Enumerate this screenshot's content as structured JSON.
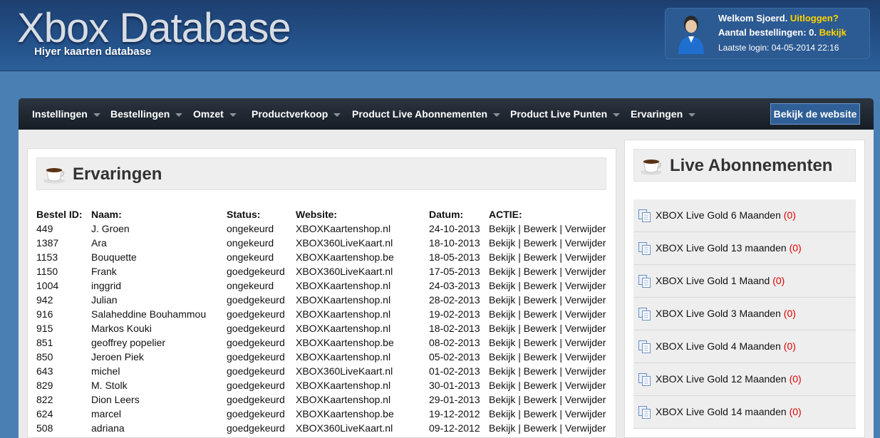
{
  "header": {
    "title": "Xbox Database",
    "subtitle": "Hiyer kaarten database",
    "user": {
      "welcome_prefix": "Welkom ",
      "username": "Sjoerd",
      "dot": ". ",
      "logout": "Uitloggen?",
      "orders_prefix": "Aantal bestellingen: 0. ",
      "view": "Bekijk",
      "last_login": "Laatste login: 04-05-2014 22:16"
    }
  },
  "nav": {
    "items": [
      {
        "label": "Instellingen"
      },
      {
        "label": "Bestellingen"
      },
      {
        "label": "Omzet"
      },
      {
        "label": "Productverkoop"
      },
      {
        "label": "Product Live Abonnementen"
      },
      {
        "label": "Product Live Punten"
      },
      {
        "label": "Ervaringen"
      }
    ],
    "site_button": "Bekijk de website"
  },
  "main": {
    "title": "Ervaringen",
    "columns": [
      "Bestel ID:",
      "Naam:",
      "Status:",
      "Website:",
      "Datum:",
      "ACTIE:"
    ],
    "actions": {
      "view": "Bekijk",
      "edit": "Bewerk",
      "delete": "Verwijder",
      "separator": " | "
    },
    "rows": [
      {
        "id": "449",
        "name": "J. Groen",
        "status": "ongekeurd",
        "website": "XBOXKaartenshop.nl",
        "date": "24-10-2013"
      },
      {
        "id": "1387",
        "name": "Ara",
        "status": "ongekeurd",
        "website": "XBOX360LiveKaart.nl",
        "date": "18-10-2013"
      },
      {
        "id": "1153",
        "name": "Bouquette",
        "status": "ongekeurd",
        "website": "XBOXKaartenshop.be",
        "date": "18-05-2013"
      },
      {
        "id": "1150",
        "name": "Frank",
        "status": "goedgekeurd",
        "website": "XBOX360LiveKaart.nl",
        "date": "17-05-2013"
      },
      {
        "id": "1004",
        "name": "inggrid",
        "status": "ongekeurd",
        "website": "XBOXKaartenshop.nl",
        "date": "24-03-2013"
      },
      {
        "id": "942",
        "name": "Julian",
        "status": "goedgekeurd",
        "website": "XBOXKaartenshop.nl",
        "date": "28-02-2013"
      },
      {
        "id": "916",
        "name": "Salaheddine Bouhammou",
        "status": "goedgekeurd",
        "website": "XBOXKaartenshop.nl",
        "date": "19-02-2013"
      },
      {
        "id": "915",
        "name": "Markos Kouki",
        "status": "goedgekeurd",
        "website": "XBOXKaartenshop.nl",
        "date": "18-02-2013"
      },
      {
        "id": "851",
        "name": "geoffrey popelier",
        "status": "goedgekeurd",
        "website": "XBOXKaartenshop.be",
        "date": "08-02-2013"
      },
      {
        "id": "850",
        "name": "Jeroen Piek",
        "status": "goedgekeurd",
        "website": "XBOXKaartenshop.nl",
        "date": "05-02-2013"
      },
      {
        "id": "643",
        "name": "michel",
        "status": "goedgekeurd",
        "website": "XBOX360LiveKaart.nl",
        "date": "01-02-2013"
      },
      {
        "id": "829",
        "name": "M. Stolk",
        "status": "goedgekeurd",
        "website": "XBOXKaartenshop.nl",
        "date": "30-01-2013"
      },
      {
        "id": "822",
        "name": "Dion Leers",
        "status": "goedgekeurd",
        "website": "XBOXKaartenshop.nl",
        "date": "29-01-2013"
      },
      {
        "id": "624",
        "name": "marcel",
        "status": "goedgekeurd",
        "website": "XBOXKaartenshop.be",
        "date": "19-12-2012"
      },
      {
        "id": "508",
        "name": "adriana",
        "status": "goedgekeurd",
        "website": "XBOX360LiveKaart.nl",
        "date": "09-12-2012"
      }
    ]
  },
  "sidebar": {
    "title": "Live Abonnementen",
    "items": [
      {
        "label": "XBOX Live Gold 6 Maanden",
        "count": "(0)"
      },
      {
        "label": "XBOX Live Gold 13 maanden",
        "count": "(0)"
      },
      {
        "label": "XBOX Live Gold 1 Maand",
        "count": "(0)"
      },
      {
        "label": "XBOX Live Gold 3 Maanden",
        "count": "(0)"
      },
      {
        "label": "XBOX Live Gold 4 Maanden",
        "count": "(0)"
      },
      {
        "label": "XBOX Live Gold 12 Maanden",
        "count": "(0)"
      },
      {
        "label": "XBOX Live Gold 14 maanden",
        "count": "(0)"
      }
    ]
  }
}
